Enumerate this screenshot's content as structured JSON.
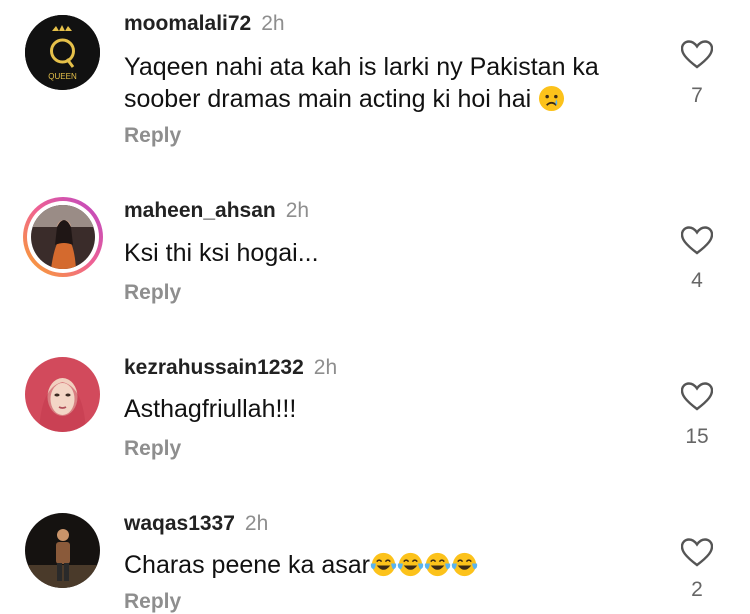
{
  "comments": [
    {
      "username": "moomalali72",
      "time": "2h",
      "text": "Yaqeen nahi ata kah is larki ny Pakistan ka soober dramas main acting ki hoi hai",
      "emoji": "crying-face",
      "reply": "Reply",
      "likes": "7",
      "avatar_text": "QUEEN"
    },
    {
      "username": "maheen_ahsan",
      "time": "2h",
      "text": "Ksi thi ksi hogai...",
      "reply": "Reply",
      "likes": "4"
    },
    {
      "username": "kezrahussain1232",
      "time": "2h",
      "text": "Asthagfriullah!!!",
      "reply": "Reply",
      "likes": "15"
    },
    {
      "username": "waqas1337",
      "time": "2h",
      "text": "Charas peene ka asar",
      "emoji": "tears-of-joy x4",
      "reply": "Reply",
      "likes": "2"
    }
  ],
  "colors": {
    "text": "#111111",
    "muted": "#8e8e8e",
    "gold": "#e6c14a"
  }
}
